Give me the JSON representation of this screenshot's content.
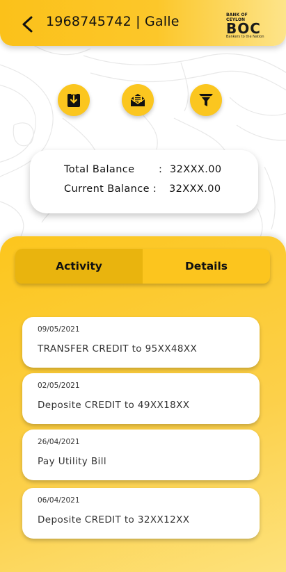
{
  "header": {
    "title": "1968745742 | Galle",
    "logo": {
      "top": "BANK OF CEYLON",
      "mark": "BOC",
      "tagline": "Bankers to the Nation"
    }
  },
  "actions": [
    {
      "name": "download-icon"
    },
    {
      "name": "mail-icon"
    },
    {
      "name": "filter-icon"
    }
  ],
  "balance": {
    "total_label": "Total Balance",
    "total_sep": ":",
    "total_value": "32XXX.00",
    "current_label": "Current Balance :",
    "current_value": "32XXX.00"
  },
  "tabs": [
    {
      "label": "Activity",
      "active": true
    },
    {
      "label": "Details",
      "active": false
    }
  ],
  "transactions": [
    {
      "date": "09/05/2021",
      "description": "TRANSFER CREDIT  to 95XX48XX"
    },
    {
      "date": "02/05/2021",
      "description": "Deposite CREDIT  to 49XX18XX"
    },
    {
      "date": "26/04/2021",
      "description": "Pay Utility Bill"
    },
    {
      "date": "06/04/2021",
      "description": "Deposite CREDIT  to 32XX12XX"
    }
  ],
  "colors": {
    "accent": "#fbc61f",
    "active_tab": "#e9b40e",
    "text": "#111111"
  }
}
